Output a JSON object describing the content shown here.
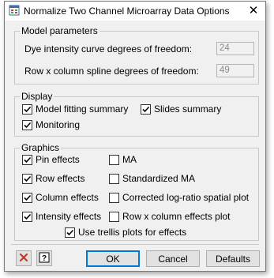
{
  "window": {
    "title": "Normalize Two Channel Microarray Data Options",
    "close_glyph": "✕"
  },
  "model_parameters": {
    "label": "Model parameters",
    "dye_label": "Dye intensity curve degrees of freedom:",
    "dye_value": "24",
    "spline_label": "Row x column spline degrees of freedom:",
    "spline_value": "49"
  },
  "display": {
    "label": "Display",
    "model_fitting_summary": {
      "label": "Model fitting summary",
      "checked": true
    },
    "slides_summary": {
      "label": "Slides summary",
      "checked": true
    },
    "monitoring": {
      "label": "Monitoring",
      "checked": true
    }
  },
  "graphics": {
    "label": "Graphics",
    "pin_effects": {
      "label": "Pin effects",
      "checked": true
    },
    "row_effects": {
      "label": "Row effects",
      "checked": true
    },
    "column_effects": {
      "label": "Column effects",
      "checked": true
    },
    "intensity_effects": {
      "label": "Intensity effects",
      "checked": true
    },
    "ma": {
      "label": "MA",
      "checked": false
    },
    "standardized_ma": {
      "label": "Standardized MA",
      "checked": false
    },
    "corrected_spatial": {
      "label": "Corrected log-ratio spatial plot",
      "checked": false
    },
    "rowcol_effects": {
      "label": "Row x column effects plot",
      "checked": false
    },
    "trellis": {
      "label": "Use trellis plots for effects",
      "checked": true
    }
  },
  "buttons": {
    "ok": "OK",
    "cancel": "Cancel",
    "defaults": "Defaults"
  },
  "icons": {
    "clear": "clear-icon",
    "help": "help-icon",
    "app": "app-icon"
  },
  "colors": {
    "clear_red": "#c0392b",
    "focus_blue": "#0078d7"
  }
}
